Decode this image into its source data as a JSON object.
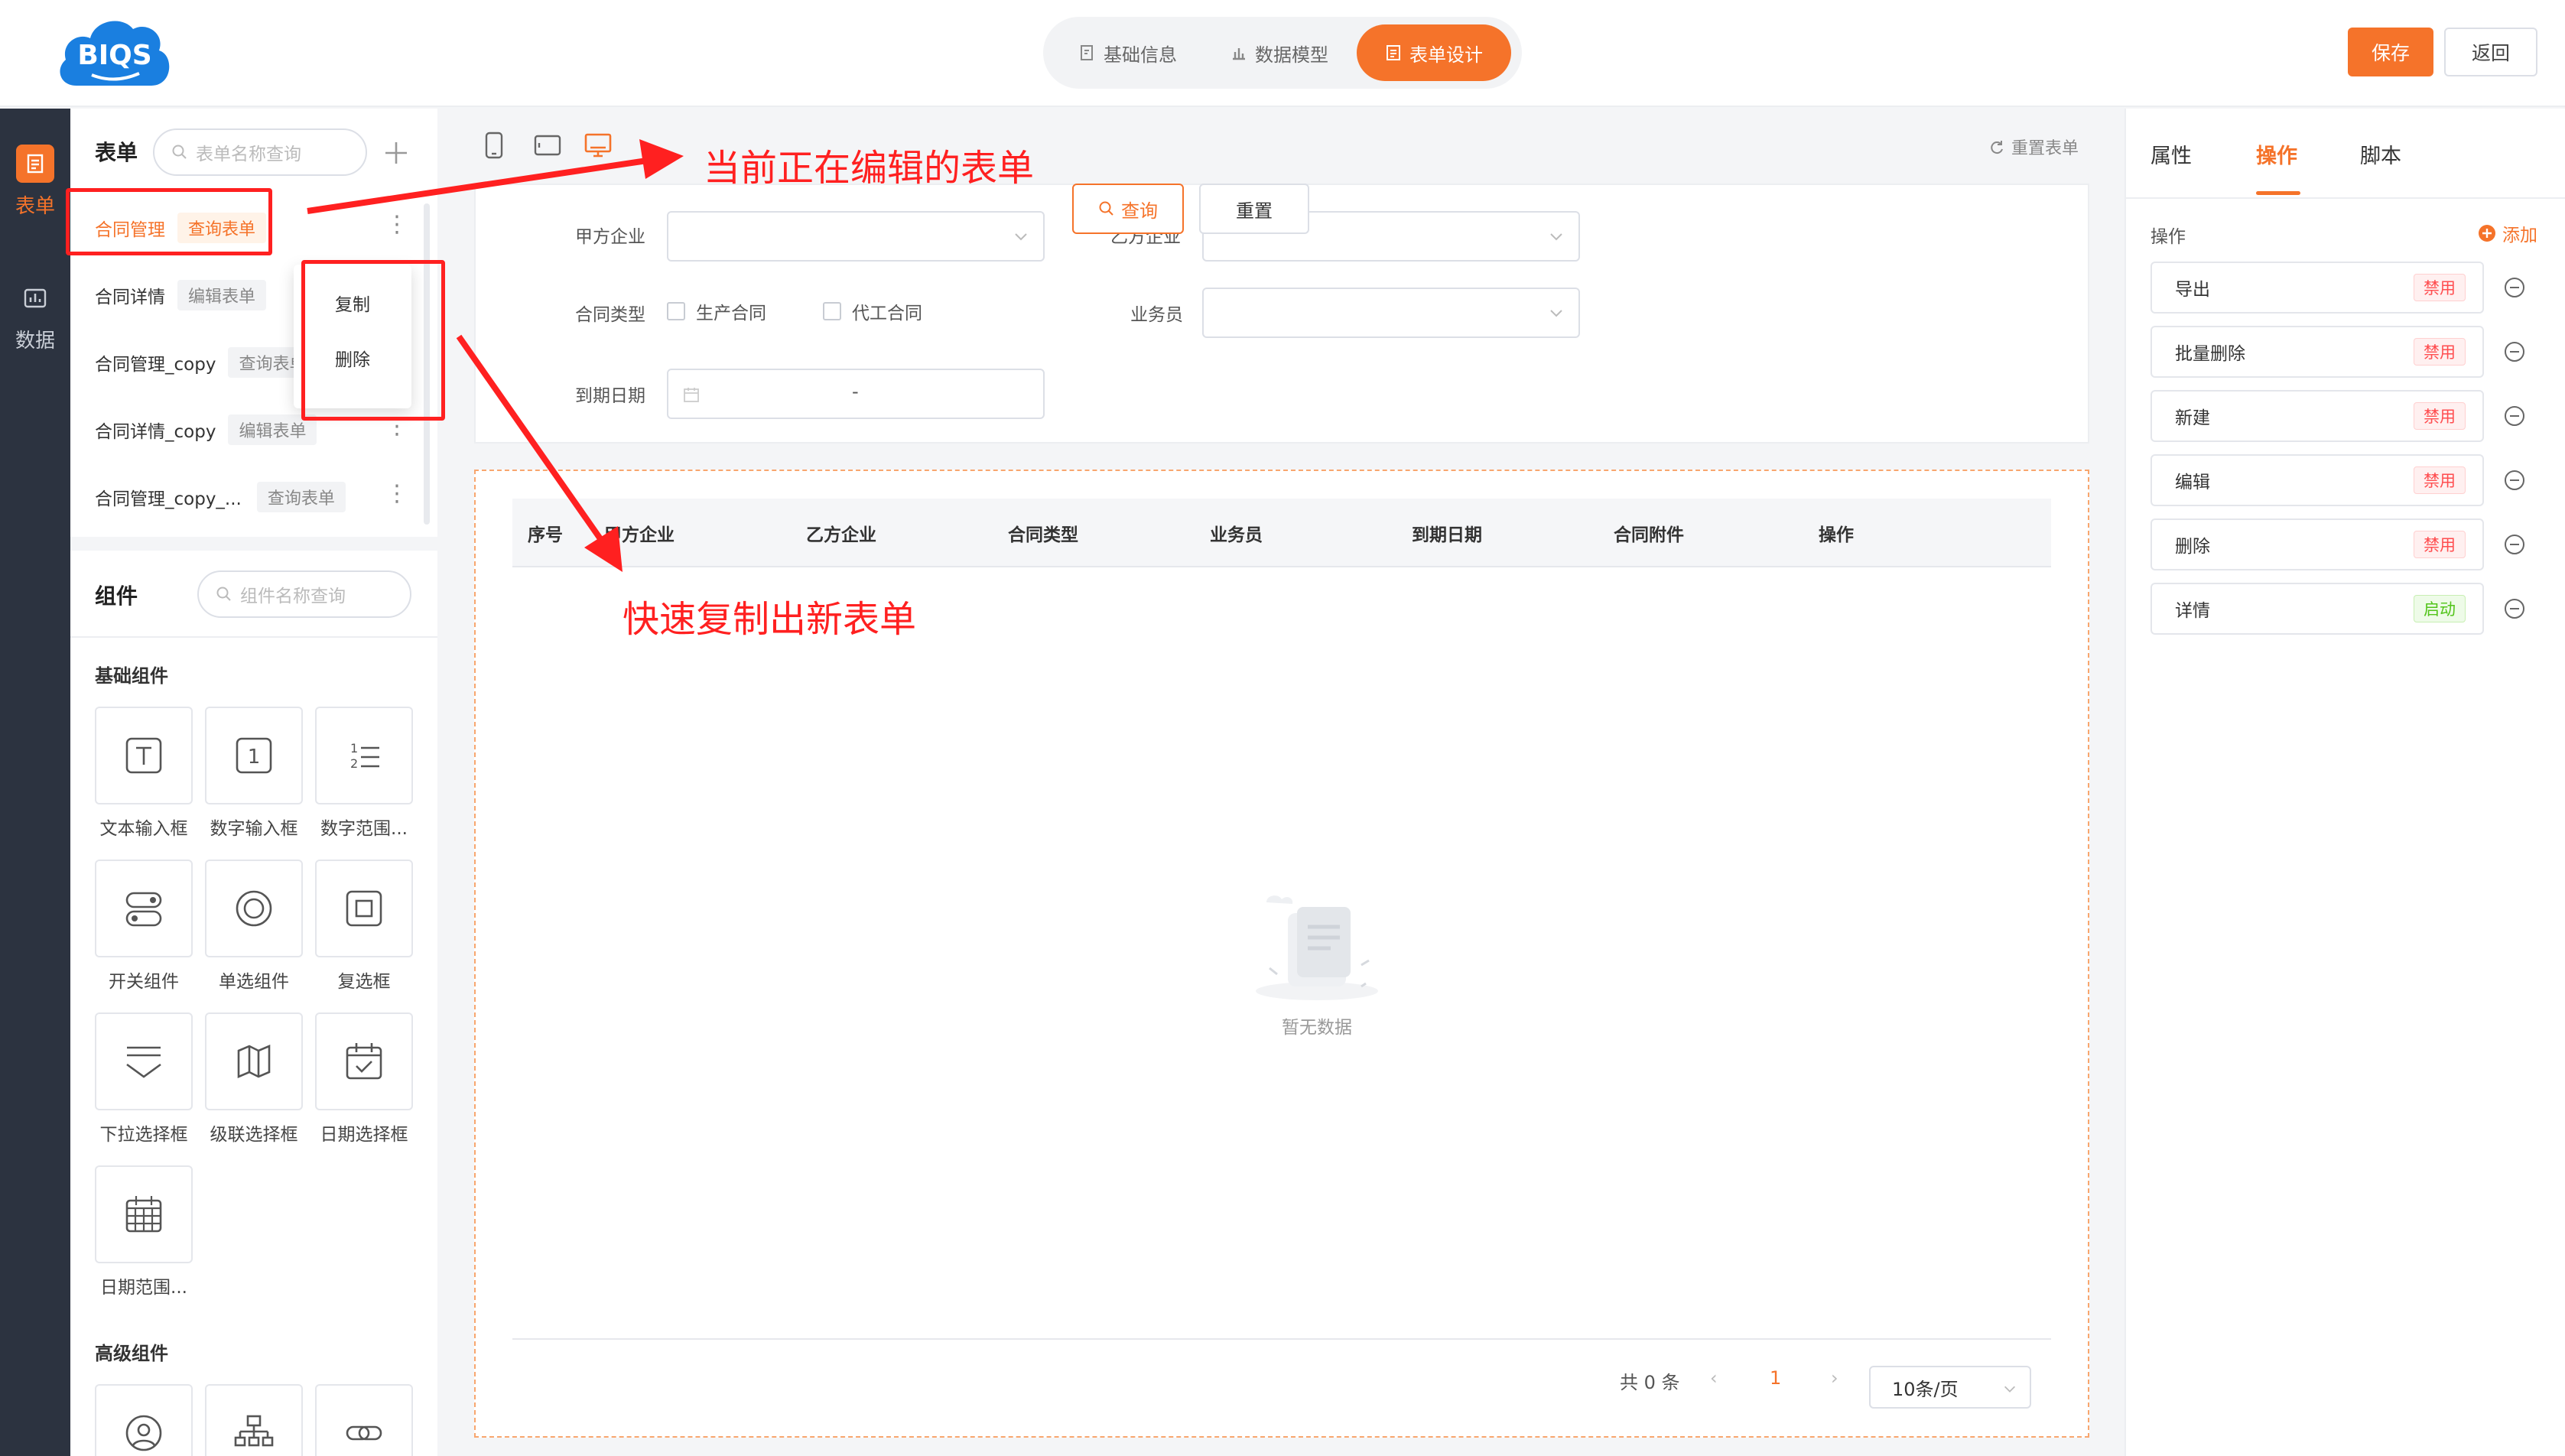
{
  "header": {
    "logo_text": "BIQS",
    "tabs": [
      {
        "label": "基础信息",
        "icon": "doc-edit-icon"
      },
      {
        "label": "数据模型",
        "icon": "bar-chart-icon"
      },
      {
        "label": "表单设计",
        "icon": "form-icon"
      }
    ],
    "active_tab": "表单设计",
    "save_label": "保存",
    "back_label": "返回"
  },
  "rail": {
    "items": [
      {
        "label": "表单",
        "icon": "form-icon",
        "active": true
      },
      {
        "label": "数据",
        "icon": "chart-icon",
        "active": false
      }
    ]
  },
  "form_panel": {
    "title": "表单",
    "search_placeholder": "表单名称查询",
    "items": [
      {
        "name": "合同管理",
        "tag": "查询表单",
        "active": true
      },
      {
        "name": "合同详情",
        "tag": "编辑表单"
      },
      {
        "name": "合同管理_copy",
        "tag": "查询表单"
      },
      {
        "name": "合同详情_copy",
        "tag": "编辑表单"
      },
      {
        "name": "合同管理_copy_...",
        "tag": "查询表单"
      }
    ],
    "context_menu": [
      "复制",
      "删除"
    ]
  },
  "component_panel": {
    "title": "组件",
    "search_placeholder": "组件名称查询",
    "basic_title": "基础组件",
    "basic": [
      {
        "label": "文本输入框",
        "icon": "text-input-icon"
      },
      {
        "label": "数字输入框",
        "icon": "number-input-icon"
      },
      {
        "label": "数字范围...",
        "icon": "number-range-icon"
      },
      {
        "label": "开关组件",
        "icon": "switch-icon"
      },
      {
        "label": "单选组件",
        "icon": "radio-icon"
      },
      {
        "label": "复选框",
        "icon": "checkbox-icon"
      },
      {
        "label": "下拉选择框",
        "icon": "dropdown-icon"
      },
      {
        "label": "级联选择框",
        "icon": "cascader-icon"
      },
      {
        "label": "日期选择框",
        "icon": "date-picker-icon"
      },
      {
        "label": "日期范围...",
        "icon": "date-range-icon"
      }
    ],
    "advanced_title": "高级组件",
    "advanced": [
      {
        "icon": "user-icon"
      },
      {
        "icon": "org-tree-icon"
      },
      {
        "icon": "link-icon"
      }
    ]
  },
  "canvas": {
    "reset_form_label": "重置表单",
    "search_fields": {
      "party_a": "甲方企业",
      "party_b": "乙方企业",
      "contract_type": "合同类型",
      "type_options": [
        "生产合同",
        "代工合同"
      ],
      "salesperson": "业务员",
      "due_date": "到期日期",
      "date_separator": "-"
    },
    "query_label": "查询",
    "reset_label": "重置",
    "columns": [
      "序号",
      "甲方企业",
      "乙方企业",
      "合同类型",
      "业务员",
      "到期日期",
      "合同附件",
      "操作"
    ],
    "empty_text": "暂无数据",
    "pager": {
      "total": "共 0 条",
      "current_page": "1",
      "page_size": "10条/页"
    }
  },
  "right_panel": {
    "tabs": [
      "属性",
      "操作",
      "脚本"
    ],
    "active_tab": "操作",
    "section_label": "操作",
    "add_label": "添加",
    "operations": [
      {
        "name": "导出",
        "status": "禁用"
      },
      {
        "name": "批量删除",
        "status": "禁用"
      },
      {
        "name": "新建",
        "status": "禁用"
      },
      {
        "name": "编辑",
        "status": "禁用"
      },
      {
        "name": "删除",
        "status": "禁用"
      },
      {
        "name": "详情",
        "status": "启动"
      }
    ]
  },
  "annotations": {
    "current_form": "当前正在编辑的表单",
    "quick_copy": "快速复制出新表单"
  },
  "colors": {
    "accent": "#f5732a",
    "rail_bg": "#2c3340",
    "annotation": "#ff2020",
    "disabled_badge": "#ff4d4f",
    "enabled_badge": "#52c41a"
  }
}
